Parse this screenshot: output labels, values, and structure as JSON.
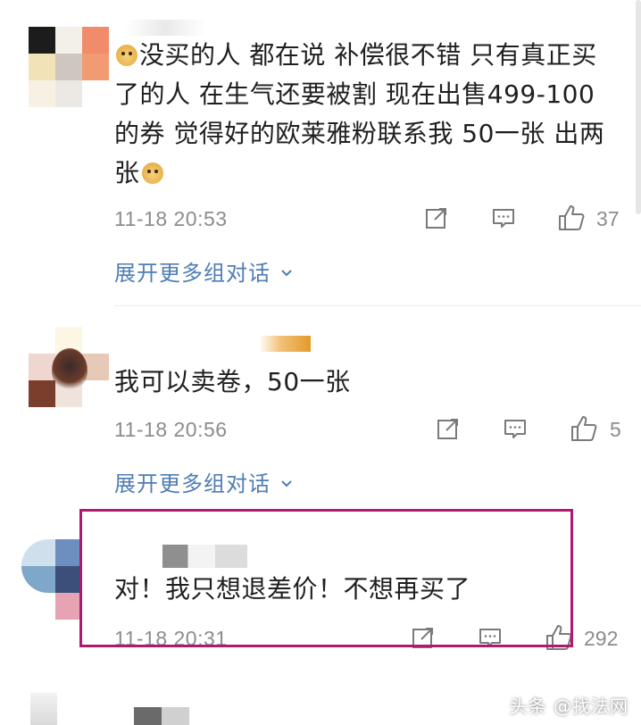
{
  "comments": [
    {
      "text_part1": "没买的人 都在说 补偿很不错 只有真正买了的人 在生气还要被割 现在出售499-100的券 觉得好的欧莱雅粉联系我 50一张 出两张",
      "timestamp": "11-18 20:53",
      "likes": "37",
      "expand_label": "展开更多组对话"
    },
    {
      "text": "我可以卖卷，50一张",
      "timestamp": "11-18 20:56",
      "likes": "5",
      "expand_label": "展开更多组对话"
    },
    {
      "text": "对！我只想退差价！不想再买了",
      "timestamp": "11-18 20:31",
      "likes": "292"
    }
  ],
  "icons": {
    "share": "share-icon",
    "reply": "comment-icon",
    "like": "thumbs-up-icon",
    "expand": "chevron-down-icon"
  },
  "colors": {
    "link": "#4f7db5",
    "highlight_border": "#b0196e",
    "meta_text": "#8c8c8c"
  },
  "watermark": "头条 @找法网"
}
